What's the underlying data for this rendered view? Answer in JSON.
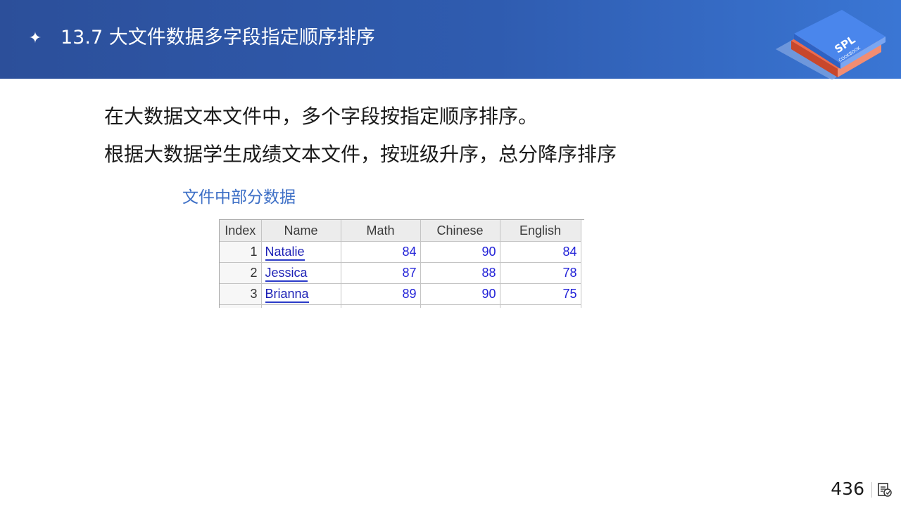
{
  "header": {
    "bullet": "✦",
    "title": "13.7 大文件数据多字段指定顺序排序",
    "logo_text": "SPL",
    "logo_subtext": "COOKBOOK",
    "colors": {
      "start": "#2c4f9a",
      "end": "#3a76d4"
    }
  },
  "body": {
    "line1": "在大数据文本文件中，多个字段按指定顺序排序。",
    "line2": "根据大数据学生成绩文本文件，按班级升序，总分降序排序",
    "caption": "文件中部分数据"
  },
  "table": {
    "columns": [
      "Index",
      "Name",
      "Math",
      "Chinese",
      "English"
    ],
    "rows": [
      {
        "index": "1",
        "name": "Natalie",
        "math": "84",
        "chinese": "90",
        "english": "84"
      },
      {
        "index": "2",
        "name": "Jessica",
        "math": "87",
        "chinese": "88",
        "english": "78"
      },
      {
        "index": "3",
        "name": "Brianna",
        "math": "89",
        "chinese": "90",
        "english": "75"
      }
    ]
  },
  "footer": {
    "page_number": "436",
    "icon": "notes-icon"
  }
}
